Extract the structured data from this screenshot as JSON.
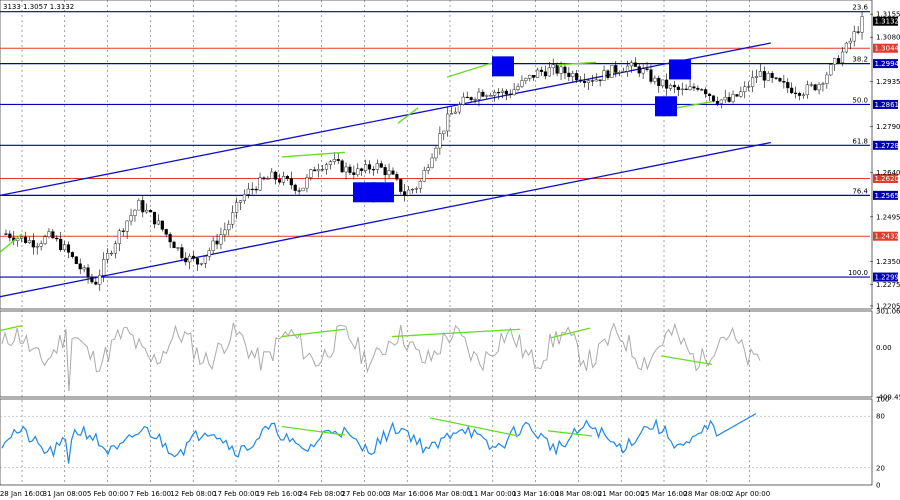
{
  "header": {
    "ohlc_text": "3133 1.3057 1.3132"
  },
  "colors": {
    "channel": "#1010c8",
    "fib_line": "#0000b0",
    "resistance": "#e03a2a",
    "divergence": "#66dd22",
    "marker": "#0000ee",
    "cci_line": "#aaaaaa",
    "rsi_line": "#1e88e5",
    "price_tag_fib": "#0000b0",
    "price_tag_red": "#e03a2a",
    "price_tag_current": "#000000"
  },
  "chart_data": [
    {
      "type": "candlestick",
      "title": "",
      "ylim": [
        1.2195,
        1.3175
      ],
      "x_ticks": [
        "28 Jan 16:00",
        "31 Jan 08:00",
        "5 Feb 00:00",
        "7 Feb 16:00",
        "12 Feb 08:00",
        "17 Feb 00:00",
        "19 Feb 16:00",
        "24 Feb 08:00",
        "27 Feb 00:00",
        "3 Mar 16:00",
        "6 Mar 08:00",
        "11 Mar 00:00",
        "13 Mar 16:00",
        "18 Mar 08:00",
        "21 Mar 00:00",
        "25 Mar 16:00",
        "28 Mar 08:00",
        "2 Apr 00:00"
      ],
      "y_ticks": [
        "1.3155",
        "1.3080",
        "1.2935",
        "1.2790",
        "1.2640",
        "1.2495",
        "1.2350",
        "1.2275",
        "1.2205"
      ],
      "close_path": [
        1.244,
        1.2425,
        1.241,
        1.2432,
        1.239,
        1.233,
        1.2275,
        1.238,
        1.247,
        1.2535,
        1.249,
        1.243,
        1.237,
        1.2345,
        1.24,
        1.2465,
        1.256,
        1.26,
        1.2625,
        1.261,
        1.2585,
        1.266,
        1.2675,
        1.265,
        1.264,
        1.2665,
        1.2635,
        1.257,
        1.26,
        1.272,
        1.282,
        1.287,
        1.29,
        1.2905,
        1.2895,
        1.293,
        1.2965,
        1.2975,
        1.2965,
        1.295,
        1.2945,
        1.297,
        1.2985,
        1.2975,
        1.2935,
        1.2915,
        1.29,
        1.2925,
        1.288,
        1.287,
        1.2905,
        1.2965,
        1.2935,
        1.2915,
        1.2905,
        1.2925,
        1.2985,
        1.305,
        1.3132
      ],
      "fib_levels": [
        {
          "label": "23.6",
          "price": 1.3163,
          "tag": ""
        },
        {
          "label": "38.2",
          "price": 1.2994,
          "tag": "1.2994"
        },
        {
          "label": "50.0",
          "price": 1.2861,
          "tag": "1.2861"
        },
        {
          "label": "61.8",
          "price": 1.2728,
          "tag": "1.2728"
        },
        {
          "label": "76.4",
          "price": 1.2565,
          "tag": "1.2565"
        },
        {
          "label": "100.0",
          "price": 1.2299,
          "tag": "1.2299"
        }
      ],
      "resistance_levels": [
        {
          "price": 1.3044,
          "tag": "1.3044"
        },
        {
          "price": 1.262,
          "tag": "1.2620"
        },
        {
          "price": 1.2432,
          "tag": "1.2432"
        }
      ],
      "current_price_tag": "1.3132",
      "channel": {
        "upper": [
          {
            "x": 0.0,
            "y": 1.2565
          },
          {
            "x": 0.886,
            "y": 1.3061
          }
        ],
        "lower": [
          {
            "x": 0.0,
            "y": 1.2235
          },
          {
            "x": 0.886,
            "y": 1.2737
          }
        ]
      },
      "markers_count": 4
    },
    {
      "type": "line",
      "indicator": "CCI",
      "ylim": [
        -409.455,
        301.0642
      ],
      "y_ticks": [
        "301.0642",
        "0.00",
        "-409.455"
      ]
    },
    {
      "type": "line",
      "indicator": "RSI",
      "ylim": [
        0,
        100
      ],
      "y_ticks": [
        "100",
        "80",
        "20",
        "0"
      ]
    }
  ]
}
